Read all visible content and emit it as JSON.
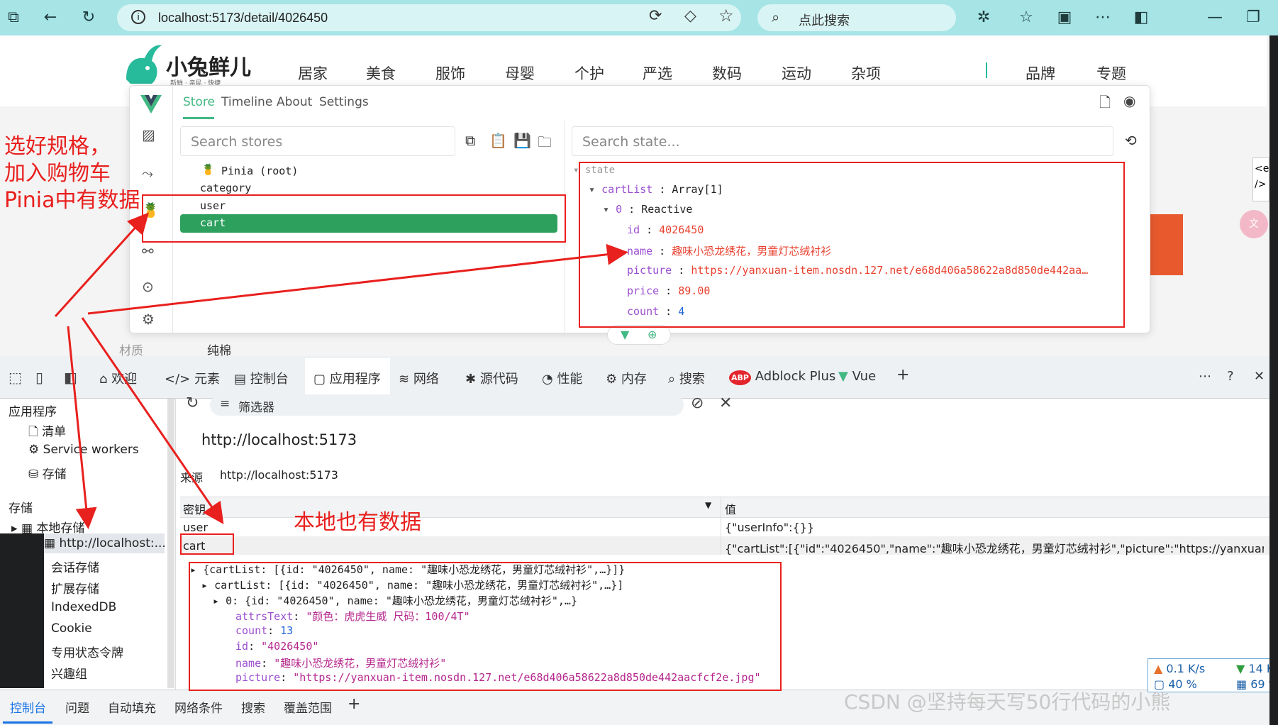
{
  "browser": {
    "url": "localhost:5173/detail/4026450",
    "search_placeholder": "点此搜索"
  },
  "site": {
    "logo_text": "小兔鲜儿",
    "logo_tagline": "新鲜 · 亲民 · 快捷",
    "nav": [
      "居家",
      "美食",
      "服饰",
      "母婴",
      "个护",
      "严选",
      "数码",
      "运动",
      "杂项"
    ],
    "nav_right": [
      "品牌",
      "专题"
    ],
    "material_label": "材质",
    "material_value": "纯棉"
  },
  "vue_devtools": {
    "tabs": [
      "Store",
      "Timeline",
      "About",
      "Settings"
    ],
    "store_search_placeholder": "Search stores",
    "state_search_placeholder": "Search state...",
    "stores": [
      "Pinia (root)",
      "category",
      "user",
      "cart"
    ],
    "selected_store": "cart",
    "state": {
      "root_label": "state",
      "cartlist_key": "cartList",
      "cartlist_type": "Array[1]",
      "item_index": "0",
      "item_type": "Reactive",
      "fields": [
        {
          "key": "id",
          "value": "4026450",
          "kind": "str"
        },
        {
          "key": "name",
          "value": "趣味小恐龙绣花，男童灯芯绒衬衫",
          "kind": "str"
        },
        {
          "key": "picture",
          "value": "https://yanxuan-item.nosdn.127.net/e68d406a58622a8d850de442aa…",
          "kind": "str"
        },
        {
          "key": "price",
          "value": "89.00",
          "kind": "str"
        },
        {
          "key": "count",
          "value": "4",
          "kind": "num"
        }
      ]
    }
  },
  "annotations": {
    "note1_line1": "选好规格，",
    "note1_line2": "加入购物车",
    "note1_line3": "Pinia中有数据",
    "note2": "本地也有数据"
  },
  "devtools": {
    "tabs": [
      "欢迎",
      "元素",
      "控制台",
      "应用程序",
      "网络",
      "源代码",
      "性能",
      "内存",
      "搜索",
      "Adblock Plus",
      "Vue"
    ],
    "active_tab": "应用程序",
    "left_panel": {
      "section_app": "应用程序",
      "app_items": [
        "清单",
        "Service workers",
        "存储"
      ],
      "section_storage": "存储",
      "storage_items": [
        "本地存储",
        "http://localhost:...",
        "会话存储",
        "扩展存储",
        "IndexedDB",
        "Cookie",
        "专用状态令牌",
        "兴趣组"
      ]
    },
    "filter_placeholder": "筛选器",
    "origin": "http://localhost:5173",
    "source_label": "来源",
    "source_value": "http://localhost:5173",
    "table": {
      "col_key": "密钥",
      "col_value": "值",
      "rows": [
        {
          "key": "user",
          "value": "{\"userInfo\":{}}"
        },
        {
          "key": "cart",
          "value": "{\"cartList\":[{\"id\":\"4026450\",\"name\":\"趣味小恐龙绣花，男童灯芯绒衬衫\",\"picture\":\"https://yanxuan-item..."
        }
      ]
    },
    "json_preview": {
      "line1": "{cartList: [{id: \"4026450\", name: \"趣味小恐龙绣花，男童灯芯绒衬衫\",…}]}",
      "line2": "cartList: [{id: \"4026450\", name: \"趣味小恐龙绣花，男童灯芯绒衬衫\",…}]",
      "line3": "0: {id: \"4026450\", name: \"趣味小恐龙绣花，男童灯芯绒衬衫\",…}",
      "attrs_key": "attrsText",
      "attrs_val": "\"颜色：虎虎生威 尺码：100/4T\"",
      "count_key": "count",
      "count_val": "13",
      "id_key": "id",
      "id_val": "\"4026450\"",
      "name_key": "name",
      "name_val": "\"趣味小恐龙绣花，男童灯芯绒衬衫\"",
      "picture_key": "picture",
      "picture_val": "\"https://yanxuan-item.nosdn.127.net/e68d406a58622a8d850de442aacfcf2e.jpg\""
    },
    "bottom_tabs": [
      "控制台",
      "问题",
      "自动填充",
      "网络条件",
      "搜索",
      "覆盖范围"
    ]
  },
  "net_monitor": {
    "up": "0.1 K/s",
    "cpu": "40 %",
    "down": "14 K",
    "mem": "69 %"
  },
  "watermark": "CSDN @坚持每天写50行代码的小熊"
}
